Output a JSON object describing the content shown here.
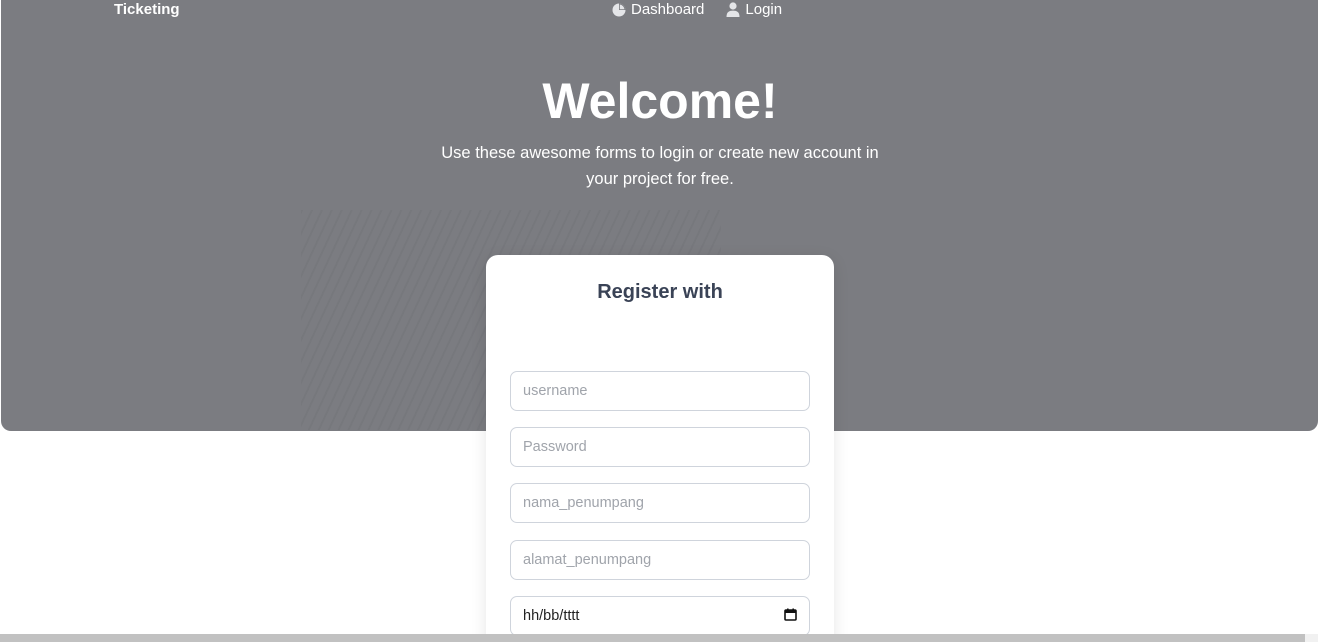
{
  "nav": {
    "brand": "Ticketing",
    "links": [
      {
        "label": "Dashboard",
        "icon": "pie-chart-icon"
      },
      {
        "label": "Login",
        "icon": "user-icon"
      }
    ]
  },
  "hero": {
    "title": "Welcome!",
    "subtitle": "Use these awesome forms to login or create new account in your project for free."
  },
  "register": {
    "title": "Register with",
    "fields": {
      "username": {
        "placeholder": "username",
        "value": ""
      },
      "password": {
        "placeholder": "Password",
        "value": ""
      },
      "nama_penumpang": {
        "placeholder": "nama_penumpang",
        "value": ""
      },
      "alamat_penumpang": {
        "placeholder": "alamat_penumpang",
        "value": ""
      },
      "date": {
        "display": "hh/bb/tttt",
        "icon": "calendar-icon"
      }
    }
  },
  "colors": {
    "hero_bg": "#7b7c81",
    "card_title": "#3a4356",
    "input_border": "#cfd4dc",
    "placeholder": "#a0a4ab"
  }
}
